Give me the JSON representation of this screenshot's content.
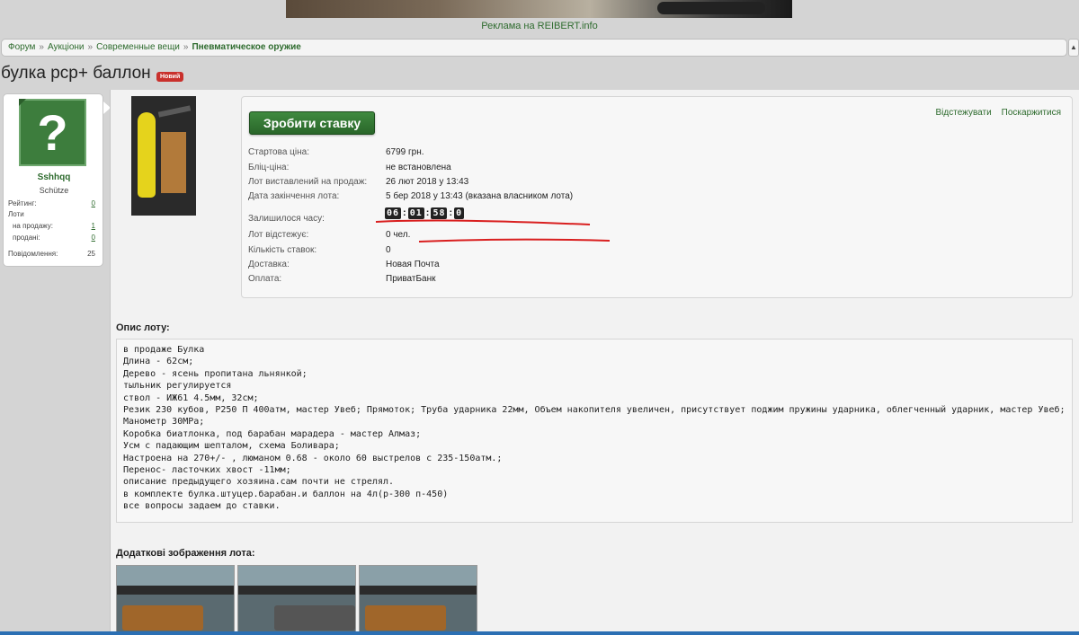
{
  "ad": {
    "caption": "Реклама на REIBERT.info"
  },
  "breadcrumb": {
    "items": [
      "Форум",
      "Аукціони",
      "Современные вещи"
    ],
    "current": "Пневматическое оружие",
    "separator": "»"
  },
  "thread": {
    "title": "булка pcp+ баллон",
    "badge": "Новий"
  },
  "user": {
    "name": "Sshhqq",
    "title": "Schütze",
    "rating_label": "Рейтинг:",
    "rating_value": "0",
    "lots_label": "Лоти",
    "for_sale_label": "на продажу:",
    "for_sale_value": "1",
    "sold_label": "продані:",
    "sold_value": "0",
    "messages_label": "Повідомлення:",
    "messages_value": "25",
    "avatar_symbol": "?"
  },
  "lot": {
    "bid_button": "Зробити ставку",
    "watch_link": "Відстежувати",
    "report_link": "Поскаржитися",
    "fields": [
      {
        "label": "Стартова ціна:",
        "value": "6799 грн."
      },
      {
        "label": "Бліц-ціна:",
        "value": "не встановлена"
      },
      {
        "label": "Лот виставлений на продаж:",
        "value": "26 лют 2018 у 13:43"
      },
      {
        "label": "Дата закінчення лота:",
        "value": "5 бер 2018 у 13:43 (вказана власником лота)"
      }
    ],
    "time_left_label": "Залишилося часу:",
    "timer": {
      "days": "06",
      "hours": "01",
      "minutes": "58",
      "seconds": "0"
    },
    "fields2": [
      {
        "label": "Лот відстежує:",
        "value": "0 чел."
      },
      {
        "label": "Кількість ставок:",
        "value": "0"
      },
      {
        "label": "Доставка:",
        "value": "Новая Почта"
      },
      {
        "label": "Оплата:",
        "value": "ПриватБанк"
      }
    ]
  },
  "description": {
    "title": "Опис лоту:",
    "lines": [
      "в продаже Булка",
      "Длина - 62см;",
      "Дерево - ясень пропитана льнянкой;",
      "тыльник регулируется",
      "ствол - ИЖ61 4.5мм, 32см;",
      "Резик 230 кубов, Р250 П 400атм, мастер Увеб; Прямоток; Труба ударника 22мм, Объем накопителя увеличен, присутствует поджим пружины ударника, облегченный ударник, мастер Увеб;",
      "Манометр 30МРа;",
      "Коробка биатлонка, под барабан марадера - мастер Алмаз;",
      "Усм с падающим шепталом, схема Боливара;",
      "Настроена на 270+/- , люманом 0.68 - около 60 выстрелов с 235-150атм.;",
      "Перенос- ласточких хвост -11мм;",
      "описание предыдущего хозяина.сам почти не стрелял.",
      "в комплекте булка.штуцер.барабан.и баллон на 4л(р-300 п-450)",
      "все вопросы задаем до ставки."
    ]
  },
  "additional_images": {
    "title": "Додаткові зображення лота:"
  },
  "colors": {
    "accent": "#2e6b2e",
    "badge": "#c9302c",
    "annotation": "#d91f1f"
  }
}
